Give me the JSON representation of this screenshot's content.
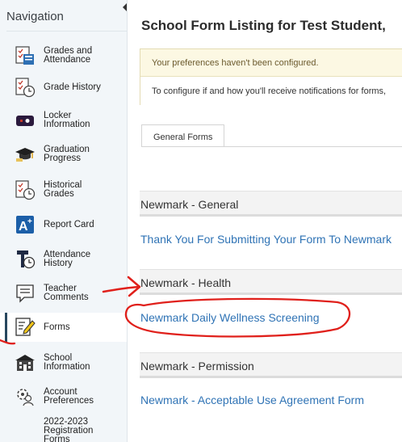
{
  "sidebar": {
    "title": "Navigation",
    "items": [
      {
        "label_line1": "Grades and",
        "label_line2": "Attendance",
        "icon": "grades-icon"
      },
      {
        "label_line1": "Grade History",
        "label_line2": "",
        "icon": "grade-history-icon"
      },
      {
        "label_line1": "Locker",
        "label_line2": "Information",
        "icon": "locker-icon"
      },
      {
        "label_line1": "Graduation",
        "label_line2": "Progress",
        "icon": "graduation-cap-icon"
      },
      {
        "label_line1": "Historical",
        "label_line2": "Grades",
        "icon": "historical-grades-icon"
      },
      {
        "label_line1": "Report Card",
        "label_line2": "",
        "icon": "report-card-icon"
      },
      {
        "label_line1": "Attendance",
        "label_line2": "History",
        "icon": "attendance-history-icon"
      },
      {
        "label_line1": "Teacher",
        "label_line2": "Comments",
        "icon": "comments-icon"
      },
      {
        "label_line1": "Forms",
        "label_line2": "",
        "icon": "forms-icon"
      },
      {
        "label_line1": "School",
        "label_line2": "Information",
        "icon": "school-icon"
      },
      {
        "label_line1": "Account",
        "label_line2": "Preferences",
        "icon": "account-preferences-icon"
      },
      {
        "label_line1": "2022-2023",
        "label_line2": "Registration",
        "label_line3": "Forms",
        "icon": ""
      }
    ]
  },
  "main": {
    "title": "School Form Listing for Test Student,",
    "alert": {
      "message": "Your preferences haven't been configured.",
      "detail": "To configure if and how you'll receive notifications for forms,"
    },
    "tab": "General Forms",
    "sections": [
      {
        "header": "Newmark - General",
        "link": "Thank You For Submitting Your Form To Newmark"
      },
      {
        "header": "Newmark - Health",
        "link": "Newmark Daily Wellness Screening"
      },
      {
        "header": "Newmark - Permission",
        "link": "Newmark - Acceptable Use Agreement Form"
      }
    ]
  },
  "colors": {
    "sidebar_bg": "#f2f6f9",
    "link": "#2f73b5",
    "alert_bg": "#fcf8e3",
    "annotation": "#e0201b"
  }
}
